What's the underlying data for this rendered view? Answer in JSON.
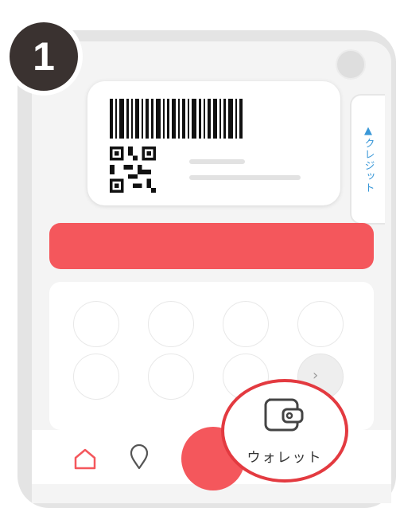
{
  "step": {
    "number": "1"
  },
  "card": {
    "credit_label": "▲クレジット"
  },
  "quick_menu": {
    "rows": 2,
    "cols": 4
  },
  "bottom_nav": {
    "items": [
      {
        "icon": "home-icon"
      },
      {
        "icon": "map-pin-icon"
      },
      {
        "icon": "center-action"
      },
      {
        "icon": "wallet-icon",
        "label": "ウォレット"
      }
    ]
  },
  "colors": {
    "accent_red": "#f4575c",
    "highlight_red": "#e33a40",
    "credit_blue": "#3a98d8",
    "badge_dark": "#3a3230"
  }
}
